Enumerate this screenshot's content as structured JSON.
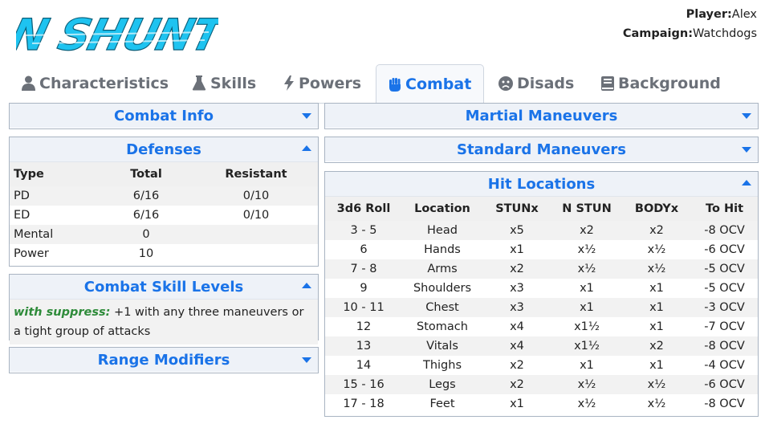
{
  "app": {
    "logo_text": "N SHUNT",
    "colors": {
      "accent": "#1a73e8",
      "logo": "#1ec3f0",
      "skill_name": "#2e8b3a"
    }
  },
  "player": {
    "label": "Player:",
    "value": "Alex"
  },
  "campaign": {
    "label": "Campaign:",
    "value": "Watchdogs"
  },
  "tabs": [
    {
      "label": "Characteristics",
      "icon": "user-icon"
    },
    {
      "label": "Skills",
      "icon": "flask-icon"
    },
    {
      "label": "Powers",
      "icon": "bolt-icon"
    },
    {
      "label": "Combat",
      "icon": "fist-icon",
      "active": true
    },
    {
      "label": "Disads",
      "icon": "sad-face-icon"
    },
    {
      "label": "Background",
      "icon": "book-icon"
    }
  ],
  "combat_info": {
    "title": "Combat Info",
    "state": "collapsed"
  },
  "defenses": {
    "title": "Defenses",
    "state": "expanded",
    "headers": [
      "Type",
      "Total",
      "Resistant"
    ],
    "rows": [
      [
        "PD",
        "6/16",
        "0/10"
      ],
      [
        "ED",
        "6/16",
        "0/10"
      ],
      [
        "Mental",
        "0",
        ""
      ],
      [
        "Power",
        "10",
        ""
      ]
    ]
  },
  "csl": {
    "title": "Combat Skill Levels",
    "state": "expanded",
    "name": "with suppress:",
    "text": "+1 with any three maneuvers or a tight group of attacks"
  },
  "range_mods": {
    "title": "Range Modifiers",
    "state": "collapsed"
  },
  "martial": {
    "title": "Martial Maneuvers",
    "state": "collapsed"
  },
  "standard": {
    "title": "Standard Maneuvers",
    "state": "collapsed"
  },
  "hit_locations": {
    "title": "Hit Locations",
    "state": "expanded",
    "headers": [
      "3d6 Roll",
      "Location",
      "STUNx",
      "N STUN",
      "BODYx",
      "To Hit"
    ],
    "rows": [
      [
        "3 - 5",
        "Head",
        "x5",
        "x2",
        "x2",
        "-8 OCV"
      ],
      [
        "6",
        "Hands",
        "x1",
        "x½",
        "x½",
        "-6 OCV"
      ],
      [
        "7 - 8",
        "Arms",
        "x2",
        "x½",
        "x½",
        "-5 OCV"
      ],
      [
        "9",
        "Shoulders",
        "x3",
        "x1",
        "x1",
        "-5 OCV"
      ],
      [
        "10 - 11",
        "Chest",
        "x3",
        "x1",
        "x1",
        "-3 OCV"
      ],
      [
        "12",
        "Stomach",
        "x4",
        "x1½",
        "x1",
        "-7 OCV"
      ],
      [
        "13",
        "Vitals",
        "x4",
        "x1½",
        "x2",
        "-8 OCV"
      ],
      [
        "14",
        "Thighs",
        "x2",
        "x1",
        "x1",
        "-4 OCV"
      ],
      [
        "15 - 16",
        "Legs",
        "x2",
        "x½",
        "x½",
        "-6 OCV"
      ],
      [
        "17 - 18",
        "Feet",
        "x1",
        "x½",
        "x½",
        "-8 OCV"
      ]
    ]
  }
}
